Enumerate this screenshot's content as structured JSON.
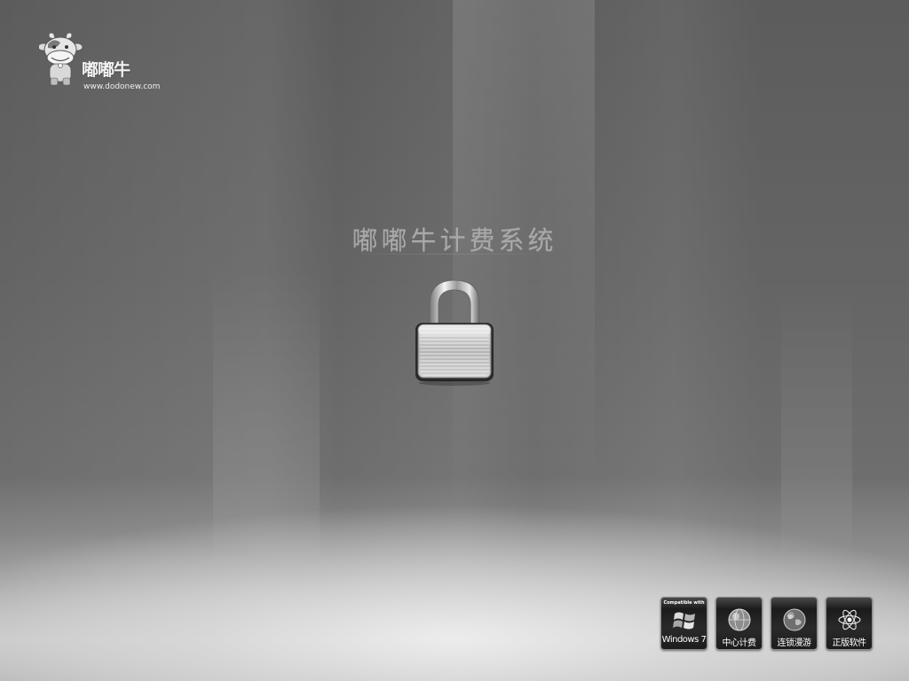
{
  "logo": {
    "name": "嘟嘟牛",
    "url": "www.dodonew.com",
    "icon": "cow-mascot-icon"
  },
  "title": "嘟嘟牛计费系统",
  "lock": {
    "icon": "padlock-icon"
  },
  "badges": [
    {
      "top_text": "Compatible with",
      "label": "Windows 7",
      "icon": "windows-logo-icon"
    },
    {
      "label": "中心计费",
      "icon": "globe-icon"
    },
    {
      "label": "连锁漫游",
      "icon": "earth-icon"
    },
    {
      "label": "正版软件",
      "icon": "atom-icon"
    }
  ],
  "colors": {
    "background": "#646464",
    "title": "#a9a9a9",
    "badge": "#1b1b1b"
  }
}
